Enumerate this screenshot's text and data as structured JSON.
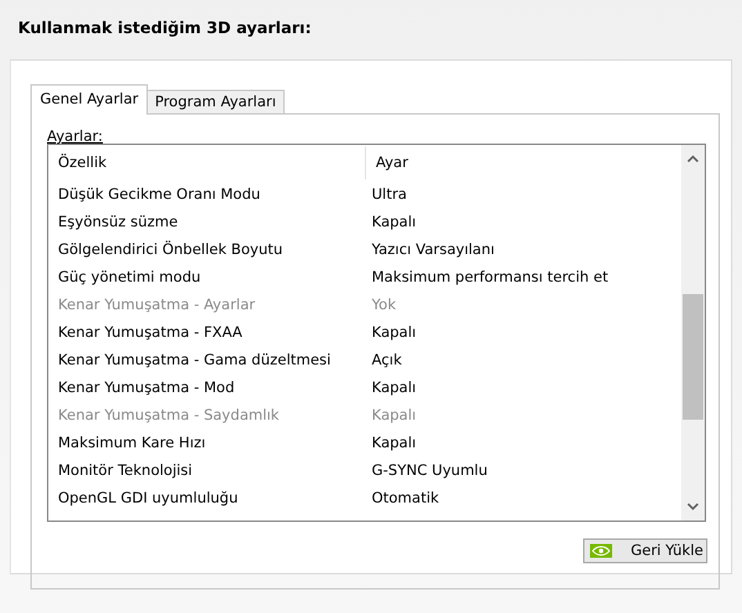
{
  "heading": "Kullanmak istediğim 3D ayarları:",
  "tabs": [
    {
      "label": "Genel Ayarlar",
      "selected": true
    },
    {
      "label": "Program Ayarları",
      "selected": false
    }
  ],
  "list_label": "Ayarlar:",
  "table": {
    "columns": [
      "Özellik",
      "Ayar"
    ],
    "rows": [
      {
        "feature": "Düşük Gecikme Oranı Modu",
        "value": "Ultra",
        "disabled": false
      },
      {
        "feature": "Eşyönsüz süzme",
        "value": "Kapalı",
        "disabled": false
      },
      {
        "feature": "Gölgelendirici Önbellek Boyutu",
        "value": "Yazıcı Varsayılanı",
        "disabled": false
      },
      {
        "feature": "Güç yönetimi modu",
        "value": "Maksimum performansı tercih et",
        "disabled": false
      },
      {
        "feature": "Kenar Yumuşatma - Ayarlar",
        "value": "Yok",
        "disabled": true
      },
      {
        "feature": "Kenar Yumuşatma - FXAA",
        "value": "Kapalı",
        "disabled": false
      },
      {
        "feature": "Kenar Yumuşatma - Gama düzeltmesi",
        "value": "Açık",
        "disabled": false
      },
      {
        "feature": "Kenar Yumuşatma - Mod",
        "value": "Kapalı",
        "disabled": false
      },
      {
        "feature": "Kenar Yumuşatma - Saydamlık",
        "value": "Kapalı",
        "disabled": true
      },
      {
        "feature": "Maksimum Kare Hızı",
        "value": "Kapalı",
        "disabled": false
      },
      {
        "feature": "Monitör Teknolojisi",
        "value": "G-SYNC Uyumlu",
        "disabled": false
      },
      {
        "feature": "OpenGL GDI uyumluluğu",
        "value": "Otomatik",
        "disabled": false
      }
    ]
  },
  "restore_button": "Geri Yükle"
}
